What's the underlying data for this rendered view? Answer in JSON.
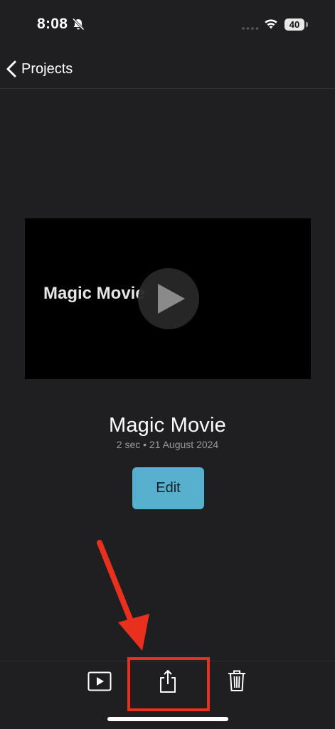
{
  "status_bar": {
    "time": "8:08",
    "battery_level": "40",
    "icons": [
      "bell-slash-icon",
      "signal-dots-icon",
      "wifi-icon",
      "battery-icon"
    ]
  },
  "nav": {
    "back_label": "Projects",
    "back_icon": "chevron-left-icon"
  },
  "video_preview": {
    "overlay_text": "Magic Movie",
    "play_icon": "play-icon"
  },
  "project": {
    "title": "Magic Movie",
    "meta": "2 sec • 21 August 2024",
    "edit_label": "Edit"
  },
  "toolbar": {
    "items": [
      {
        "icon": "play-preview-icon"
      },
      {
        "icon": "share-icon"
      },
      {
        "icon": "trash-icon"
      }
    ]
  },
  "colors": {
    "background": "#1f1f21",
    "edit_button": "#58b0cf",
    "annotation": "#e8301c",
    "meta_text": "#9a9aa0"
  }
}
